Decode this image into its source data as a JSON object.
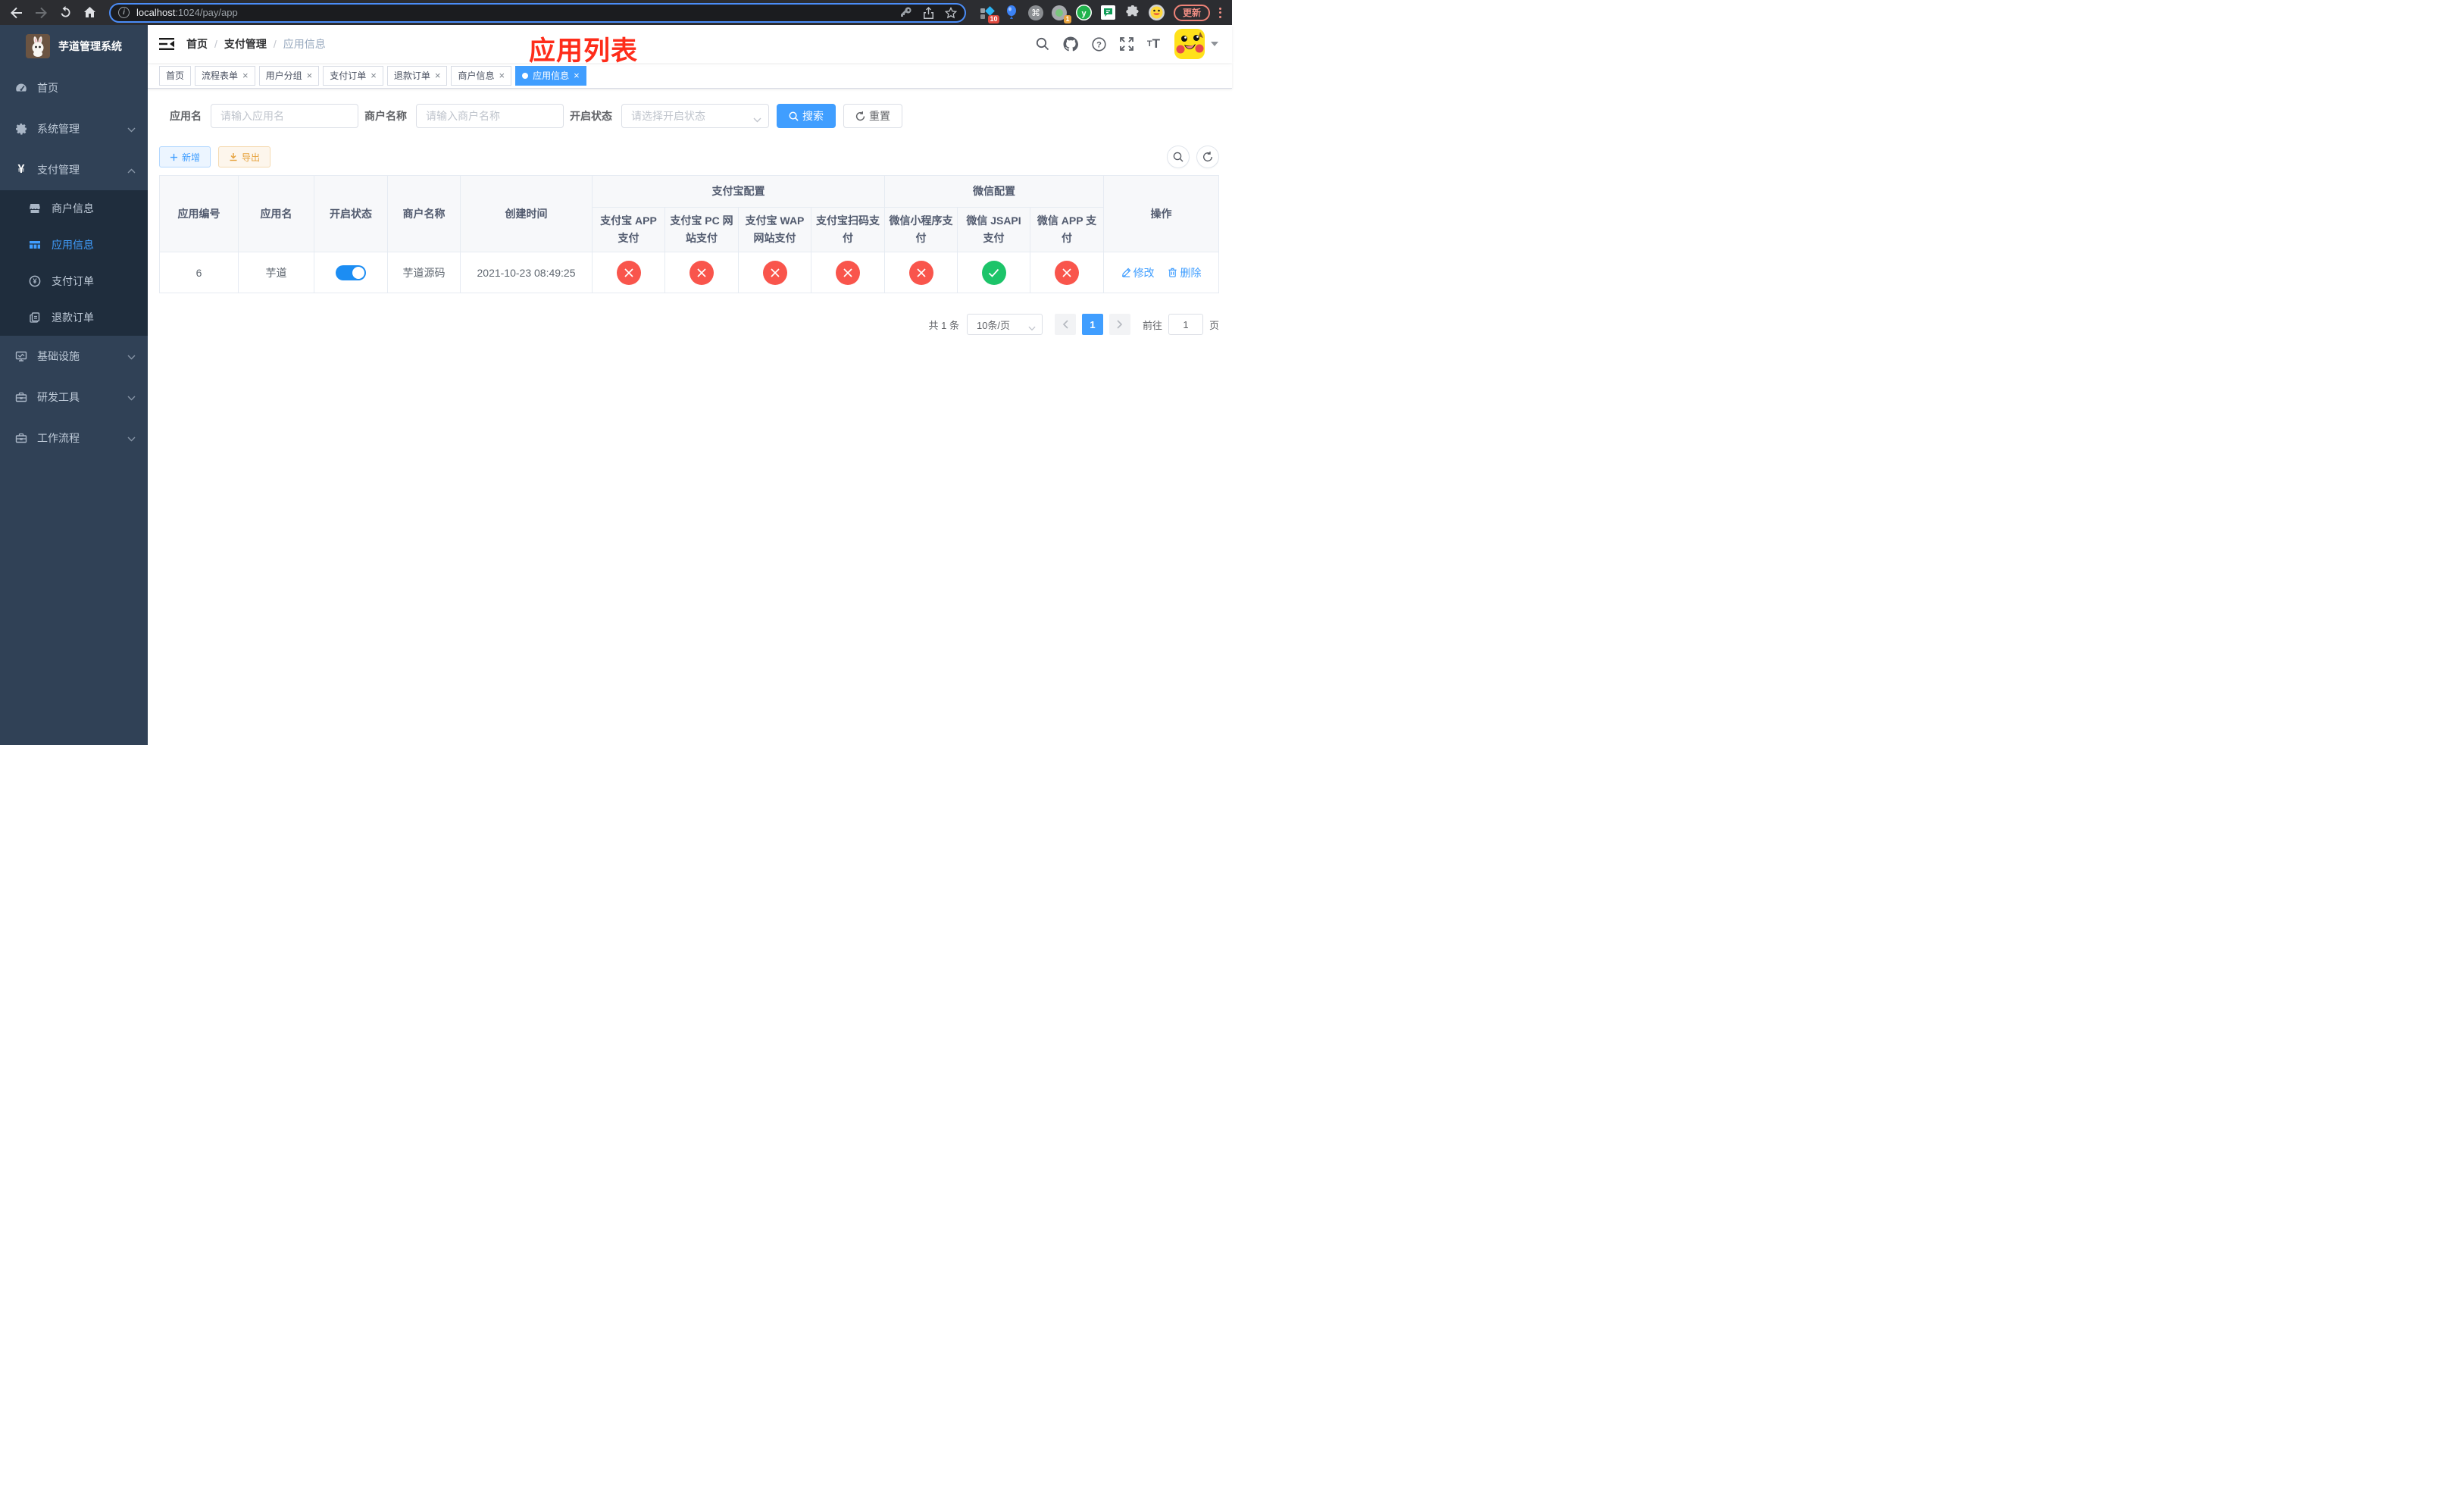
{
  "browser": {
    "url": {
      "host": "localhost",
      "path": ":1024/pay/app"
    },
    "update_label": "更新",
    "ext_badges": {
      "pieces": "10",
      "recorder": "1"
    },
    "y_ext_letter": "y"
  },
  "sidebar": {
    "logo_title": "芋道管理系统",
    "items": [
      {
        "label": "首页"
      },
      {
        "label": "系统管理"
      },
      {
        "label": "支付管理"
      },
      {
        "label": "商户信息"
      },
      {
        "label": "应用信息"
      },
      {
        "label": "支付订单"
      },
      {
        "label": "退款订单"
      },
      {
        "label": "基础设施"
      },
      {
        "label": "研发工具"
      },
      {
        "label": "工作流程"
      }
    ]
  },
  "navbar": {
    "breadcrumb": [
      "首页",
      "支付管理",
      "应用信息"
    ]
  },
  "annotation": {
    "title": "应用列表",
    "color": "#fe2c1a"
  },
  "tags": [
    {
      "label": "首页"
    },
    {
      "label": "流程表单"
    },
    {
      "label": "用户分组"
    },
    {
      "label": "支付订单"
    },
    {
      "label": "退款订单"
    },
    {
      "label": "商户信息"
    },
    {
      "label": "应用信息"
    }
  ],
  "search": {
    "fields": [
      {
        "label": "应用名",
        "placeholder": "请输入应用名"
      },
      {
        "label": "商户名称",
        "placeholder": "请输入商户名称"
      },
      {
        "label": "开启状态",
        "placeholder": "请选择开启状态"
      }
    ],
    "search_label": "搜索",
    "reset_label": "重置"
  },
  "toolbar": {
    "add_label": "新增",
    "export_label": "导出"
  },
  "table": {
    "headers": {
      "id": "应用编号",
      "name": "应用名",
      "status": "开启状态",
      "merchant": "商户名称",
      "created": "创建时间",
      "alipay_group": "支付宝配置",
      "wechat_group": "微信配置",
      "actions": "操作",
      "sub": [
        "支付宝 APP 支付",
        "支付宝 PC 网站支付",
        "支付宝 WAP 网站支付",
        "支付宝扫码支付",
        "微信小程序支付",
        "微信 JSAPI 支付",
        "微信 APP 支付"
      ]
    },
    "row": {
      "id": "6",
      "name": "芋道",
      "enabled": true,
      "merchant": "芋道源码",
      "created": "2021-10-23 08:49:25",
      "statuses": [
        "cross",
        "cross",
        "cross",
        "cross",
        "cross",
        "check",
        "cross"
      ],
      "edit_label": "修改",
      "delete_label": "删除"
    }
  },
  "pagination": {
    "total": "共 1 条",
    "page_size": "10条/页",
    "page": "1",
    "goto_label": "前往",
    "goto_value": "1",
    "unit_label": "页"
  },
  "colors": {
    "primary": "#409eff",
    "success": "#1cc469",
    "danger": "#f9554c",
    "warning": "#e6a23c",
    "sidebar_bg": "#304156",
    "submenu_bg": "#1f2d3d"
  }
}
